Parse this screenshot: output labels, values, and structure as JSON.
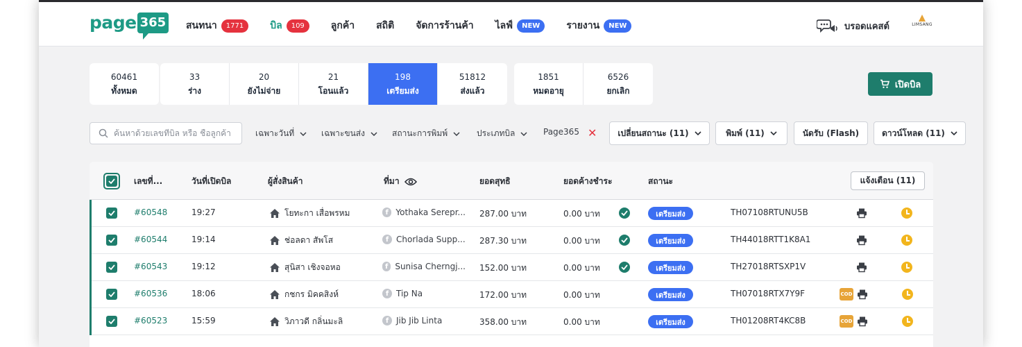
{
  "header": {
    "logo_text": "page",
    "logo_bubble": "365",
    "nav": [
      {
        "label": "สนทนา",
        "badge": "1771",
        "badge_color": "red",
        "active": false
      },
      {
        "label": "บิล",
        "badge": "109",
        "badge_color": "red",
        "active": true
      },
      {
        "label": "ลูกค้า",
        "badge": "",
        "active": false
      },
      {
        "label": "สถิติ",
        "badge": "",
        "active": false
      },
      {
        "label": "จัดการร้านค้า",
        "badge": "",
        "active": false
      },
      {
        "label": "ไลฟ์",
        "badge": "NEW",
        "badge_color": "blue",
        "active": false
      },
      {
        "label": "รายงาน",
        "badge": "NEW",
        "badge_color": "blue",
        "active": false
      }
    ],
    "broadcast_label": "บรอดแคสต์",
    "shop_logo_text": "LIMSANG"
  },
  "status_tabs": [
    {
      "count": "60461",
      "label": "ทั้งหมด"
    },
    {
      "count": "33",
      "label": "ร่าง"
    },
    {
      "count": "20",
      "label": "ยังไม่จ่าย"
    },
    {
      "count": "21",
      "label": "โอนแล้ว"
    },
    {
      "count": "198",
      "label": "เตรียมส่ง",
      "active": true
    },
    {
      "count": "51812",
      "label": "ส่งแล้ว"
    },
    {
      "count": "1851",
      "label": "หมดอายุ"
    },
    {
      "count": "6526",
      "label": "ยกเลิก"
    }
  ],
  "open_bill_label": "เปิดบิล",
  "search": {
    "placeholder": "ค้นหาด้วยเลขที่บิล หรือ ชื่อลูกค้า"
  },
  "filters": [
    "เฉพาะวันที่",
    "เฉพาะขนส่ง",
    "สถานะการพิมพ์",
    "ประเภทบิล"
  ],
  "active_filter": "Page365",
  "actions": {
    "change_status": "เปลี่ยนสถานะ (11)",
    "print": "พิมพ์ (11)",
    "pickup": "นัดรับ (Flash)",
    "download": "ดาวน์โหลด (11)"
  },
  "table": {
    "columns": {
      "bill_no": "เลขที่...",
      "date": "วันที่เปิดบิล",
      "customer": "ผู้สั่งสินค้า",
      "source": "ที่มา",
      "net": "ยอดสุทธิ",
      "due": "ยอดค้างชำระ",
      "status": "สถานะ"
    },
    "notify_label": "แจ้งเตือน (11)",
    "rows": [
      {
        "bill": "#60548",
        "time": "19:27",
        "customer": "โยทะกา เสื่อพรหม",
        "source": "Yothaka Serepr...",
        "net": "287.00 บาท",
        "due": "0.00 บาท",
        "paid": true,
        "status": "เตรียมส่ง",
        "tracking": "TH07108RTUNU5B",
        "cod": false
      },
      {
        "bill": "#60544",
        "time": "19:14",
        "customer": "ช่อลดา สัพโส",
        "source": "Chorlada Supp...",
        "net": "287.30 บาท",
        "due": "0.00 บาท",
        "paid": true,
        "status": "เตรียมส่ง",
        "tracking": "TH44018RTT1K8A1",
        "cod": false
      },
      {
        "bill": "#60543",
        "time": "19:12",
        "customer": "สุนิสา เชิงจอหอ",
        "source": "Sunisa Cherngj...",
        "net": "152.00 บาท",
        "due": "0.00 บาท",
        "paid": true,
        "status": "เตรียมส่ง",
        "tracking": "TH27018RTSXP1V",
        "cod": false
      },
      {
        "bill": "#60536",
        "time": "18:06",
        "customer": "กชกร มิคคสิงห์",
        "source": "Tip Na",
        "net": "172.00 บาท",
        "due": "0.00 บาท",
        "paid": false,
        "status": "เตรียมส่ง",
        "tracking": "TH07018RTX7Y9F",
        "cod": true
      },
      {
        "bill": "#60523",
        "time": "15:59",
        "customer": "วิภาวดี กลิ่นมะลิ",
        "source": "Jib Jib Linta",
        "net": "358.00 บาท",
        "due": "0.00 บาท",
        "paid": false,
        "status": "เตรียมส่ง",
        "tracking": "TH01208RT4KC8B",
        "cod": true
      }
    ],
    "cod_label": "COD"
  }
}
